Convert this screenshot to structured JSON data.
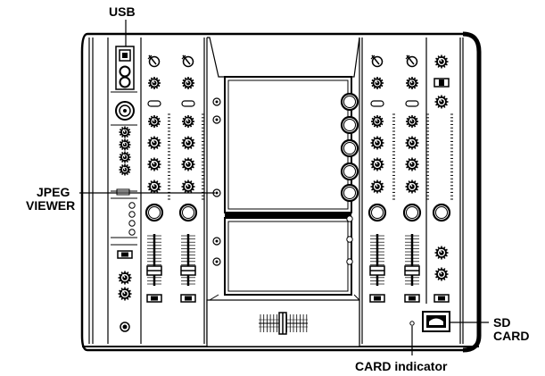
{
  "callouts": {
    "usb": "USB",
    "jpeg_line1": "JPEG",
    "jpeg_line2": "VIEWER",
    "sd_line1": "SD",
    "sd_line2": "CARD",
    "card_indicator": "CARD indicator"
  },
  "colors": {
    "line": "#000000",
    "fill": "#ffffff",
    "screen": "#e6e6e6",
    "shadow": "#1a1a1a"
  }
}
